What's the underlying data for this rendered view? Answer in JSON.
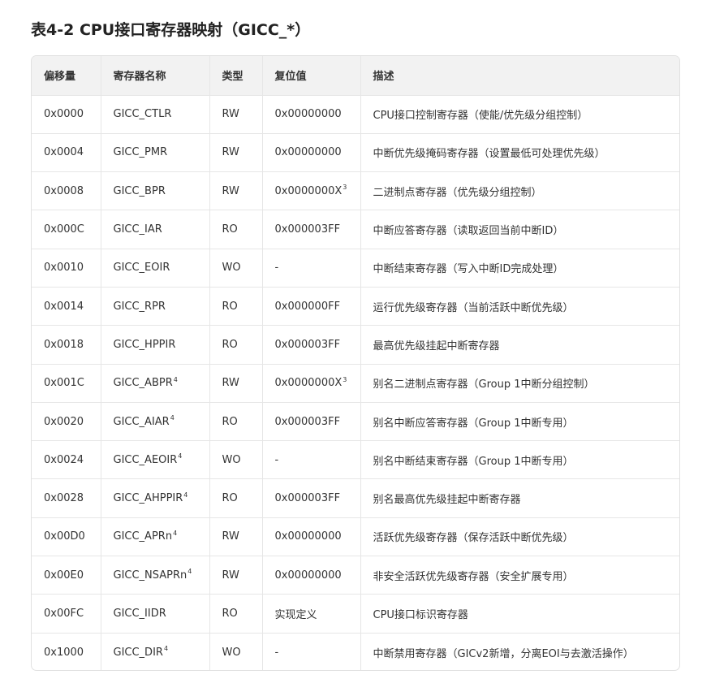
{
  "title": "表4-2 CPU接口寄存器映射（GICC_*）",
  "table": {
    "headers": [
      "偏移量",
      "寄存器名称",
      "类型",
      "复位值",
      "描述"
    ],
    "rows": [
      {
        "offset": "0x0000",
        "name": "GICC_CTLR",
        "name_sup": "",
        "type": "RW",
        "reset": "0x00000000",
        "reset_sup": "",
        "desc": "CPU接口控制寄存器（使能/优先级分组控制）"
      },
      {
        "offset": "0x0004",
        "name": "GICC_PMR",
        "name_sup": "",
        "type": "RW",
        "reset": "0x00000000",
        "reset_sup": "",
        "desc": "中断优先级掩码寄存器（设置最低可处理优先级）"
      },
      {
        "offset": "0x0008",
        "name": "GICC_BPR",
        "name_sup": "",
        "type": "RW",
        "reset": "0x0000000X",
        "reset_sup": "3",
        "desc": "二进制点寄存器（优先级分组控制）"
      },
      {
        "offset": "0x000C",
        "name": "GICC_IAR",
        "name_sup": "",
        "type": "RO",
        "reset": "0x000003FF",
        "reset_sup": "",
        "desc": "中断应答寄存器（读取返回当前中断ID）"
      },
      {
        "offset": "0x0010",
        "name": "GICC_EOIR",
        "name_sup": "",
        "type": "WO",
        "reset": "-",
        "reset_sup": "",
        "desc": "中断结束寄存器（写入中断ID完成处理）"
      },
      {
        "offset": "0x0014",
        "name": "GICC_RPR",
        "name_sup": "",
        "type": "RO",
        "reset": "0x000000FF",
        "reset_sup": "",
        "desc": "运行优先级寄存器（当前活跃中断优先级）"
      },
      {
        "offset": "0x0018",
        "name": "GICC_HPPIR",
        "name_sup": "",
        "type": "RO",
        "reset": "0x000003FF",
        "reset_sup": "",
        "desc": "最高优先级挂起中断寄存器"
      },
      {
        "offset": "0x001C",
        "name": "GICC_ABPR",
        "name_sup": "4",
        "type": "RW",
        "reset": "0x0000000X",
        "reset_sup": "3",
        "desc": "别名二进制点寄存器（Group 1中断分组控制）"
      },
      {
        "offset": "0x0020",
        "name": "GICC_AIAR",
        "name_sup": "4",
        "type": "RO",
        "reset": "0x000003FF",
        "reset_sup": "",
        "desc": "别名中断应答寄存器（Group 1中断专用）"
      },
      {
        "offset": "0x0024",
        "name": "GICC_AEOIR",
        "name_sup": "4",
        "type": "WO",
        "reset": "-",
        "reset_sup": "",
        "desc": "别名中断结束寄存器（Group 1中断专用）"
      },
      {
        "offset": "0x0028",
        "name": "GICC_AHPPIR",
        "name_sup": "4",
        "type": "RO",
        "reset": "0x000003FF",
        "reset_sup": "",
        "desc": "别名最高优先级挂起中断寄存器"
      },
      {
        "offset": "0x00D0",
        "name": "GICC_APRn",
        "name_sup": "4",
        "type": "RW",
        "reset": "0x00000000",
        "reset_sup": "",
        "desc": "活跃优先级寄存器（保存活跃中断优先级）"
      },
      {
        "offset": "0x00E0",
        "name": "GICC_NSAPRn",
        "name_sup": "4",
        "type": "RW",
        "reset": "0x00000000",
        "reset_sup": "",
        "desc": "非安全活跃优先级寄存器（安全扩展专用）"
      },
      {
        "offset": "0x00FC",
        "name": "GICC_IIDR",
        "name_sup": "",
        "type": "RO",
        "reset": "实现定义",
        "reset_sup": "",
        "desc": "CPU接口标识寄存器"
      },
      {
        "offset": "0x1000",
        "name": "GICC_DIR",
        "name_sup": "4",
        "type": "WO",
        "reset": "-",
        "reset_sup": "",
        "desc": "中断禁用寄存器（GICv2新增，分离EOI与去激活操作）"
      }
    ]
  }
}
